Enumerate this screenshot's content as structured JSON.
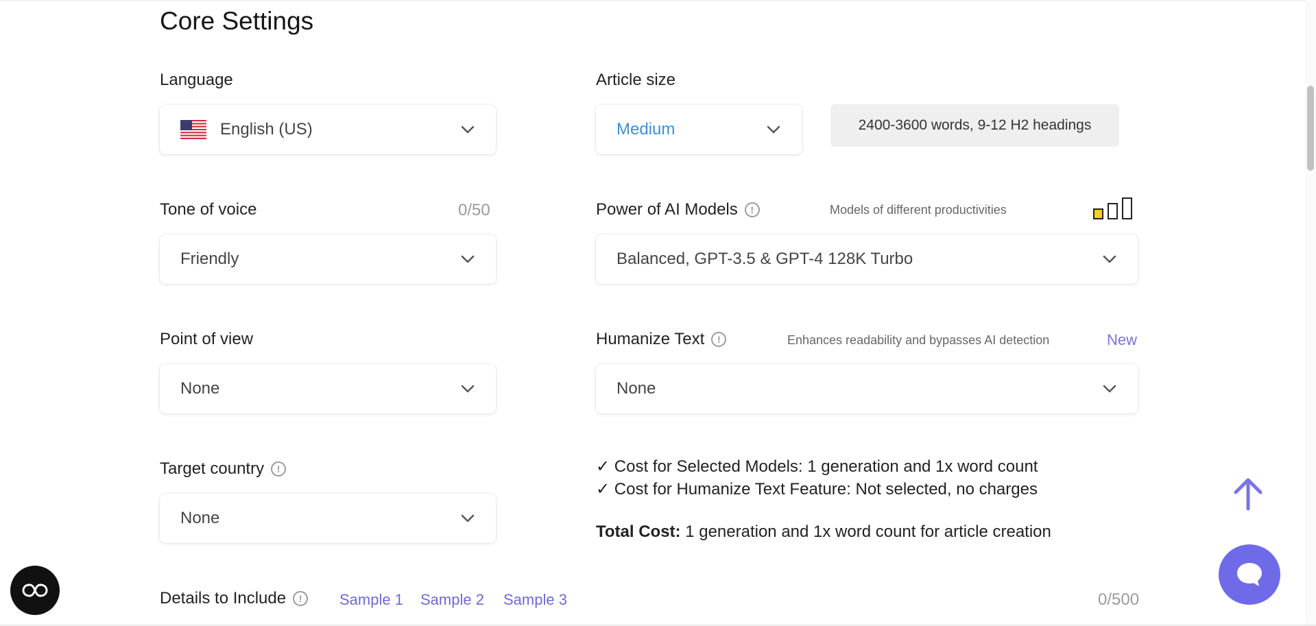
{
  "page": {
    "title": "Core Settings"
  },
  "language": {
    "label": "Language",
    "value": "English (US)",
    "flag_icon": "us-flag-icon"
  },
  "article_size": {
    "label": "Article size",
    "value": "Medium",
    "value_color": "#3d8fd6",
    "note": "2400-3600 words, 9-12 H2 headings"
  },
  "tone_of_voice": {
    "label": "Tone of voice",
    "counter": "0/50",
    "value": "Friendly"
  },
  "ai_models": {
    "label": "Power of AI Models",
    "hint": "Models of different productivities",
    "value": "Balanced, GPT-3.5 & GPT-4 128K Turbo",
    "productivity_level": 1,
    "productivity_max": 3,
    "active_color": "#f2d21b"
  },
  "point_of_view": {
    "label": "Point of view",
    "value": "None"
  },
  "humanize": {
    "label": "Humanize Text",
    "hint": "Enhances readability and bypasses AI detection",
    "badge": "New",
    "value": "None"
  },
  "target_country": {
    "label": "Target country",
    "value": "None"
  },
  "cost": {
    "line1": "✓ Cost for Selected Models: 1 generation and 1x word count",
    "line2": "✓ Cost for Humanize Text Feature: Not selected, no charges",
    "total_label": "Total Cost:",
    "total_value": " 1 generation and 1x word count for article creation"
  },
  "details": {
    "label": "Details to Include",
    "counter": "0/500",
    "samples": [
      "Sample 1",
      "Sample 2",
      "Sample 3"
    ]
  },
  "accent_color": "#6f6ae8"
}
